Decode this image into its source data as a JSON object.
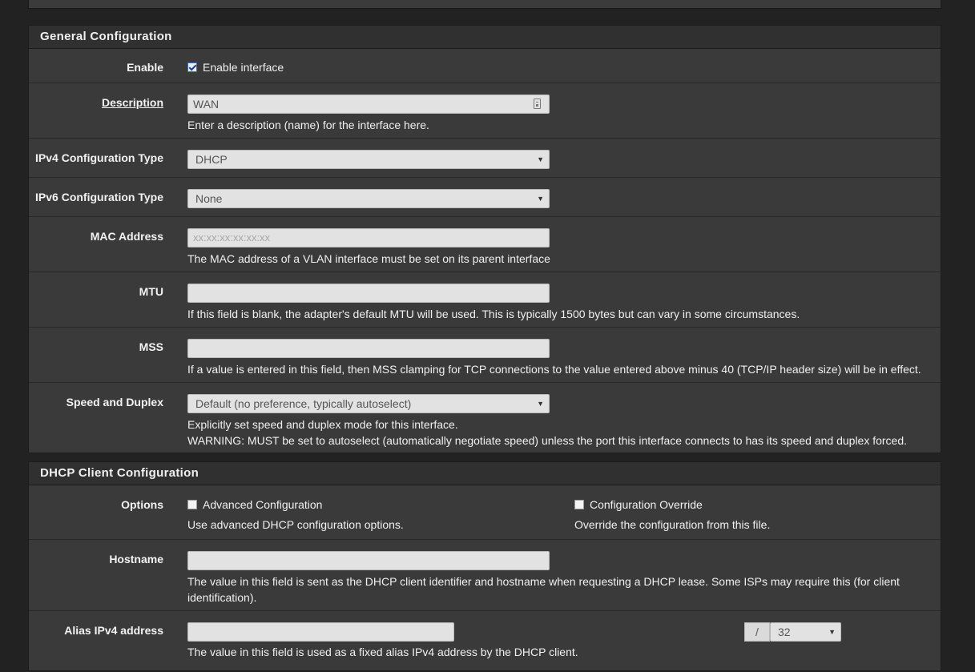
{
  "general": {
    "heading": "General Configuration",
    "enable": {
      "label": "Enable",
      "checkbox_label": "Enable interface",
      "checked": true
    },
    "description": {
      "label": "Description",
      "value": "WAN",
      "help": "Enter a description (name) for the interface here."
    },
    "ipv4_type": {
      "label": "IPv4 Configuration Type",
      "value": "DHCP"
    },
    "ipv6_type": {
      "label": "IPv6 Configuration Type",
      "value": "None"
    },
    "mac": {
      "label": "MAC Address",
      "placeholder": "xx:xx:xx:xx:xx:xx",
      "help": "The MAC address of a VLAN interface must be set on its parent interface"
    },
    "mtu": {
      "label": "MTU",
      "value": "",
      "help": "If this field is blank, the adapter's default MTU will be used. This is typically 1500 bytes but can vary in some circumstances."
    },
    "mss": {
      "label": "MSS",
      "value": "",
      "help": "If a value is entered in this field, then MSS clamping for TCP connections to the value entered above minus 40 (TCP/IP header size) will be in effect."
    },
    "speed": {
      "label": "Speed and Duplex",
      "value": "Default (no preference, typically autoselect)",
      "help1": "Explicitly set speed and duplex mode for this interface.",
      "help2": "WARNING: MUST be set to autoselect (automatically negotiate speed) unless the port this interface connects to has its speed and duplex forced."
    }
  },
  "dhcp": {
    "heading": "DHCP Client Configuration",
    "options": {
      "label": "Options",
      "advanced_label": "Advanced Configuration",
      "advanced_checked": false,
      "advanced_help": "Use advanced DHCP configuration options.",
      "override_label": "Configuration Override",
      "override_checked": false,
      "override_help": "Override the configuration from this file."
    },
    "hostname": {
      "label": "Hostname",
      "value": "",
      "help1": "The value in this field is sent as the DHCP client identifier and hostname when requesting a DHCP lease. Some ISPs may require this (for client",
      "help2": "identification)."
    },
    "alias": {
      "label": "Alias IPv4 address",
      "value": "",
      "slash": "/",
      "cidr": "32",
      "help": "The value in this field is used as a fixed alias IPv4 address by the DHCP client."
    }
  },
  "colors": {
    "background": "#222222",
    "panel": "#3a3a3a",
    "heading": "#303030",
    "input": "#e2e2e2"
  }
}
